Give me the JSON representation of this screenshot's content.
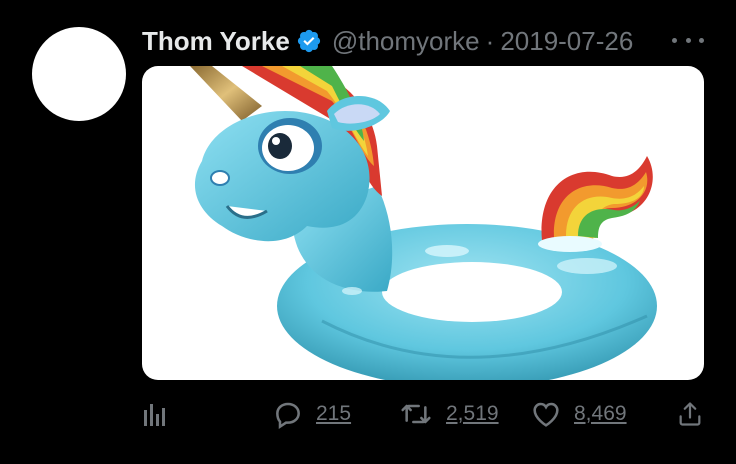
{
  "tweet": {
    "author_name": "Thom Yorke",
    "handle": "@thomyorke",
    "separator": "·",
    "date": "2019-07-26",
    "verified_icon": "verified-badge-icon",
    "more_icon": "more-options-icon",
    "media_description_icon": "unicorn-pool-float-image"
  },
  "actions": {
    "analytics_icon": "analytics-icon",
    "reply_icon": "reply-icon",
    "reply_count": "215",
    "retweet_icon": "retweet-icon",
    "retweet_count": "2,519",
    "like_icon": "heart-icon",
    "like_count": "8,469",
    "share_icon": "share-icon"
  },
  "colors": {
    "background": "#000000",
    "name_text": "#e7e9ea",
    "secondary_text": "#71767b",
    "verified_badge": "#1d9bf0"
  }
}
